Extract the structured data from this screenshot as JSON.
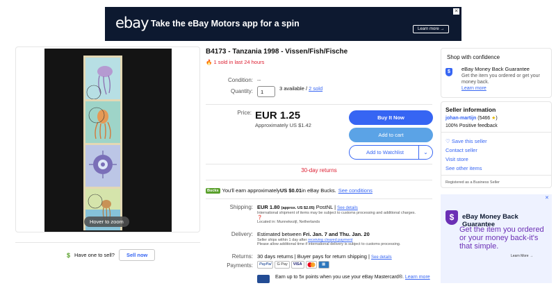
{
  "banner": {
    "logo": "ebay",
    "headline": "Take the eBay Motors app for a spin",
    "cta": "Learn more →",
    "close": "✕"
  },
  "gallery": {
    "hover_hint": "Hover to zoom"
  },
  "sell": {
    "icon": "$",
    "prompt": "Have one to sell?",
    "button": "Sell now"
  },
  "listing": {
    "title": "B4173 - Tanzania 1998 - Vissen/Fish/Fische",
    "sold_badge": "1 sold in last 24 hours",
    "condition_label": "Condition:",
    "condition_value": "--",
    "quantity_label": "Quantity:",
    "quantity_value": "1",
    "available": "3 available / ",
    "sold_link": "2 sold",
    "price_label": "Price:",
    "price": "EUR 1.25",
    "approx_price": "Approximately US $1.42",
    "buy_now": "Buy It Now",
    "add_to_cart": "Add to cart",
    "add_to_watchlist": "Add to Watchlist",
    "returns_banner": "30-day returns",
    "bucks_logo": "Bucks",
    "bucks_text": "You'll earn approximately ",
    "bucks_amount": "US $0.01",
    "bucks_suffix": " in eBay Bucks. ",
    "bucks_link": "See conditions",
    "shipping_label": "Shipping:",
    "shipping_price": "EUR 1.80",
    "shipping_approx": "(approx. US $2.05)",
    "shipping_carrier": "PostNL | ",
    "shipping_details_link": "See details",
    "shipping_note": "International shipment of items may be subject to customs processing and additional charges.",
    "location": "Located in: Munnekezijl, Netherlands",
    "delivery_label": "Delivery:",
    "delivery_prefix": "Estimated between ",
    "delivery_dates": "Fri. Jan. 7 and Thu. Jan. 20",
    "delivery_note_1": "Seller ships within 1 day after ",
    "delivery_note_link": "receiving cleared payment",
    "delivery_note_2": "Please allow additional time if international delivery is subject to customs processing.",
    "returns_label": "Returns:",
    "returns_value": "30 days returns | Buyer pays for return shipping | ",
    "returns_link": "See details",
    "payments_label": "Payments:",
    "payment_methods": [
      "PayPal",
      "G Pay",
      "VISA"
    ],
    "mastercard_text": "Earn up to 5x points when you use your eBay Mastercard®. ",
    "mastercard_link": "Learn more"
  },
  "confidence": {
    "heading": "Shop with confidence",
    "guarantee_title": "eBay Money Back Guarantee",
    "guarantee_desc": "Get the item you ordered or get your money back.",
    "learn_more": "Learn more"
  },
  "seller": {
    "heading": "Seller information",
    "name": "johan-martijn",
    "score": " (5466 ",
    "star": "★",
    "score_close": ")",
    "feedback": "100% Positive feedback",
    "save_seller": "Save this seller",
    "contact": "Contact seller",
    "visit_store": "Visit store",
    "other_items": "See other items",
    "registered": "Registered as a Business Seller"
  },
  "ad": {
    "title": "eBay Money Back Guarantee",
    "body": "Get the item you ordered or your money back-it's that simple.",
    "learn_more": "Learn More →",
    "close": "✕"
  },
  "colors": {
    "brand_blue": "#3665f3",
    "sold_red": "#dd1e31",
    "banner_bg": "#0d1930",
    "ad_purple": "#6b2fb5"
  }
}
